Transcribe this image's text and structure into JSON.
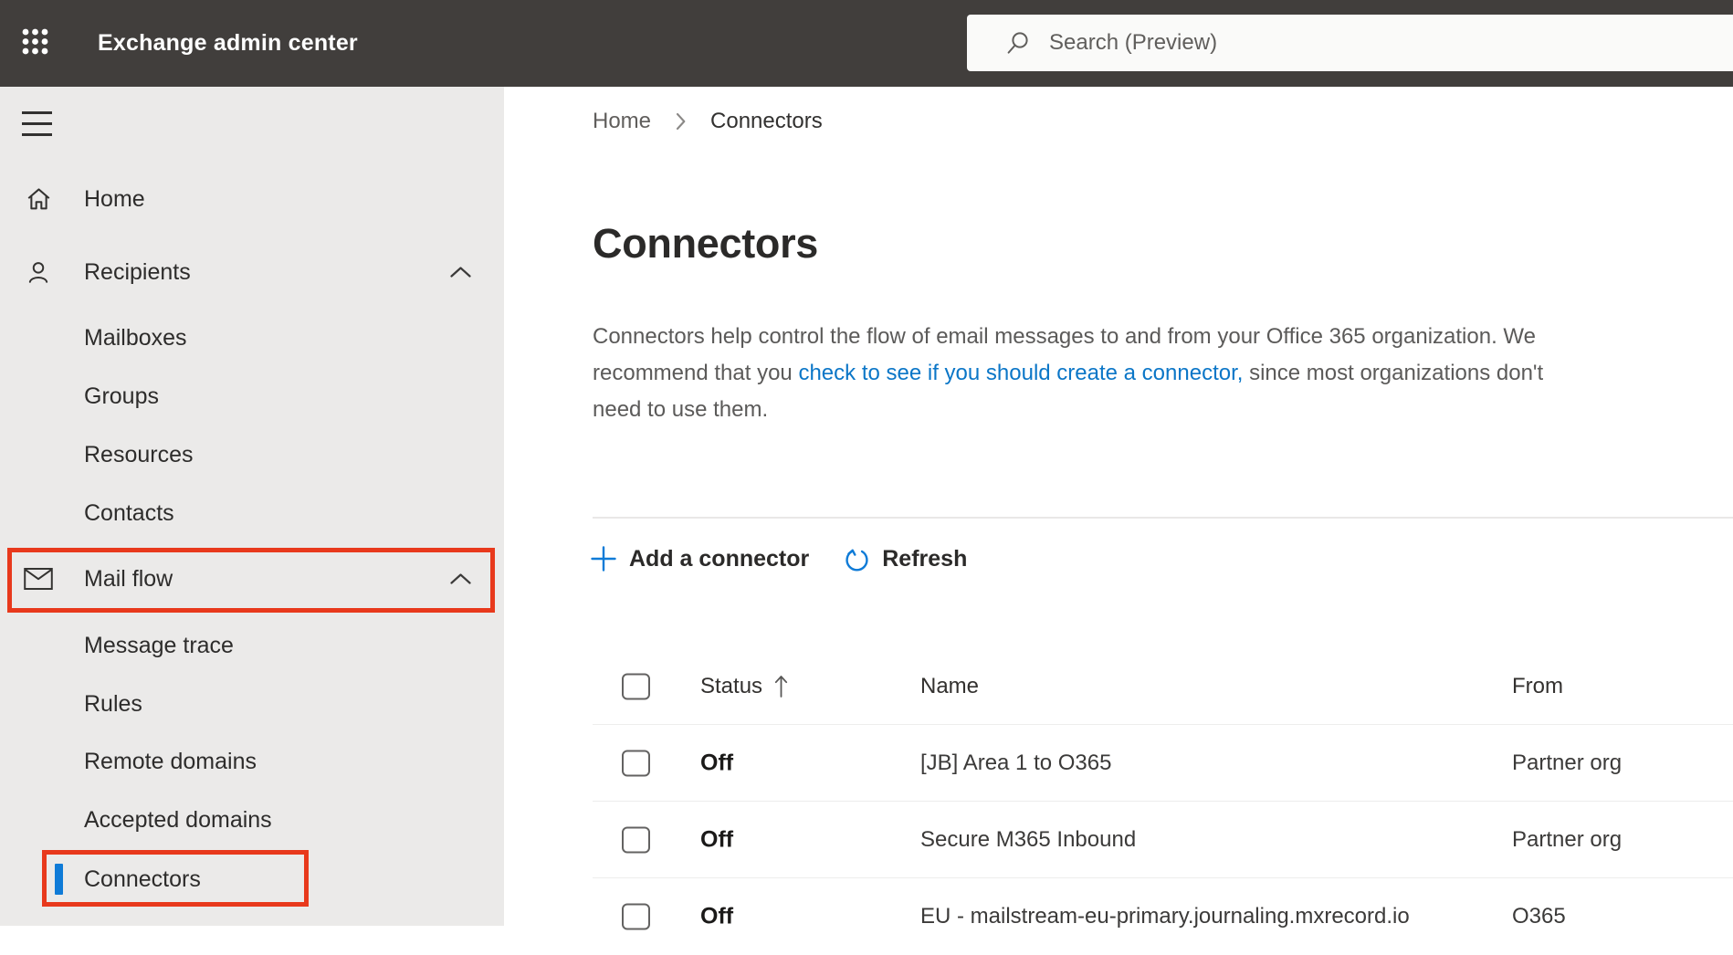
{
  "header": {
    "app_title": "Exchange admin center",
    "search_placeholder": "Search (Preview)"
  },
  "icons": {
    "app_launcher": "waffle-grid-dots",
    "search": "magnifier",
    "nav_toggle": "hamburger",
    "breadcrumb_separator": "chevron-right",
    "sort_indicator": "arrow-up"
  },
  "sidebar": {
    "items": [
      {
        "label": "Home",
        "icon": "home",
        "level": 1
      },
      {
        "label": "Recipients",
        "icon": "person",
        "level": 1,
        "expanded": true
      },
      {
        "label": "Mailboxes",
        "level": 2
      },
      {
        "label": "Groups",
        "level": 2
      },
      {
        "label": "Resources",
        "level": 2
      },
      {
        "label": "Contacts",
        "level": 2
      },
      {
        "label": "Mail flow",
        "icon": "mail",
        "level": 1,
        "expanded": true,
        "annotated": true
      },
      {
        "label": "Message trace",
        "level": 2
      },
      {
        "label": "Rules",
        "level": 2
      },
      {
        "label": "Remote domains",
        "level": 2
      },
      {
        "label": "Accepted domains",
        "level": 2
      },
      {
        "label": "Connectors",
        "level": 2,
        "selected": true,
        "annotated": true
      }
    ]
  },
  "breadcrumb": {
    "items": [
      "Home",
      "Connectors"
    ]
  },
  "page": {
    "title": "Connectors",
    "description": {
      "line1": "Connectors help control the flow of email messages to and from your Office 365 organization. We",
      "line2_before_link": "recommend that you ",
      "link": "check to see if you should create a connector,",
      "line2_after_link": " since most organizations don't",
      "line3": "need to use them."
    }
  },
  "toolbar": {
    "add_label": "Add a connector",
    "refresh_label": "Refresh"
  },
  "table": {
    "columns": [
      "Status",
      "Name",
      "From"
    ],
    "sorted_column": "Status",
    "sort_direction": "ascending",
    "rows": [
      {
        "status": "Off",
        "name": "[JB] Area 1 to O365",
        "from": "Partner org"
      },
      {
        "status": "Off",
        "name": "Secure M365 Inbound",
        "from": "Partner org"
      },
      {
        "status": "Off",
        "name": "EU - mailstream-eu-primary.journaling.mxrecord.io",
        "from": "O365"
      }
    ]
  },
  "annotations": [
    {
      "target": "Mail flow",
      "shape": "red-rectangle"
    },
    {
      "target": "Connectors",
      "shape": "red-rectangle"
    }
  ],
  "colors": {
    "topbar_bg": "#413e3c",
    "sidebar_bg": "#ebeae9",
    "accent_blue": "#0f7bd7",
    "link_blue": "#0b76c7",
    "annotation_red": "#e8391c",
    "text_dark": "#2b2a29",
    "text_gray": "#5b5a59"
  }
}
